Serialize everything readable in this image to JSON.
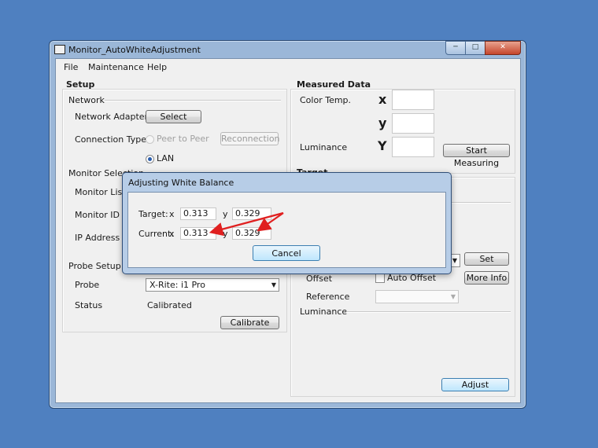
{
  "window": {
    "title": "Monitor_AutoWhiteAdjustment",
    "controls": [
      "minimize",
      "maximize",
      "close"
    ]
  },
  "menu": [
    "File",
    "Maintenance",
    "Help"
  ],
  "setup": {
    "title": "Setup",
    "network": {
      "title": "Network",
      "adapter_label": "Network Adapter",
      "select_button": "Select",
      "connection_label": "Connection Type",
      "peer_label": "Peer to Peer",
      "reconnect_button": "Reconnection",
      "lan_label": "LAN",
      "selected": "LAN"
    },
    "monitor_selection": {
      "title": "Monitor Selection",
      "list_label": "Monitor List",
      "id_label": "Monitor ID",
      "ip_label": "IP Address"
    },
    "probe_setup": {
      "title": "Probe Setup",
      "probe_label": "Probe",
      "probe_value": "X-Rite: i1 Pro",
      "status_label": "Status",
      "status_value": "Calibrated",
      "calibrate_button": "Calibrate"
    }
  },
  "measured": {
    "title": "Measured Data",
    "color_temp_label": "Color Temp.",
    "x_symbol": "x",
    "y_symbol": "y",
    "luminance_label": "Luminance",
    "Y_symbol": "Y",
    "start_button": "Start Measuring"
  },
  "target": {
    "title": "Target",
    "set_button": "Set",
    "offset_label": "Offset",
    "auto_offset_label": "Auto Offset",
    "more_info_button": "More Info",
    "reference_label": "Reference",
    "luminance_label": "Luminance",
    "adjust_button": "Adjust"
  },
  "dialog": {
    "title": "Adjusting White Balance",
    "target_label": "Target:",
    "current_label": "Current:",
    "x_label": "x",
    "y_label": "y",
    "target_x": "0.313",
    "target_y": "0.329",
    "current_x": "0.313",
    "current_y": "0.329",
    "cancel_button": "Cancel"
  },
  "colors": {
    "desktop": "#4f80c0",
    "annotation_arrow": "#e02020",
    "window_frame": "#9bb7d8"
  }
}
